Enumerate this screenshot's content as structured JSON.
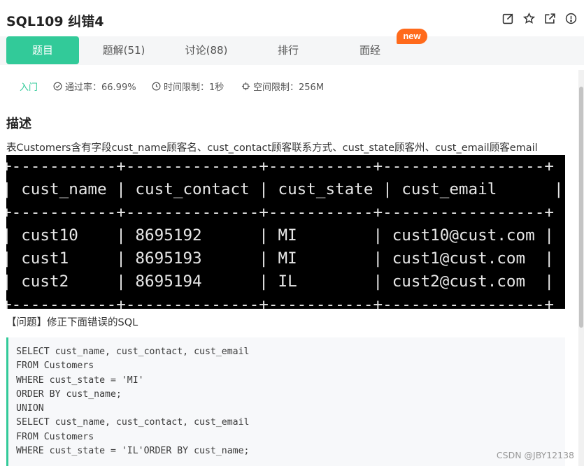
{
  "header": {
    "title": "SQL109  纠错4",
    "icons": [
      "edit-icon",
      "star-icon",
      "external-link-icon",
      "info-icon"
    ]
  },
  "tabs": [
    {
      "label": "题目",
      "active": true
    },
    {
      "label": "题解(51)",
      "active": false
    },
    {
      "label": "讨论(88)",
      "active": false
    },
    {
      "label": "排行",
      "active": false
    },
    {
      "label": "面经",
      "active": false
    }
  ],
  "new_badge": "new",
  "meta": {
    "level": "入门",
    "pass_rate": "通过率：66.99%",
    "time_limit": "时间限制：1秒",
    "space_limit": "空间限制：256M"
  },
  "section_title": "描述",
  "description": "表Customers含有字段cust_name顾客名、cust_contact顾客联系方式、cust_state顾客州、cust_email顾客email",
  "table_text": [
    "+-----------+--------------+-----------+-----------------+",
    "| cust_name | cust_contact | cust_state | cust_email      |",
    "+-----------+--------------+-----------+-----------------+",
    "| cust10    | 8695192      | MI        | cust10@cust.com |",
    "| cust1     | 8695193      | MI        | cust1@cust.com  |",
    "| cust2     | 8695194      | IL        | cust2@cust.com  |",
    "+-----------+--------------+-----------+-----------------+"
  ],
  "question": "【问题】修正下面错误的SQL",
  "code_lines": [
    "SELECT cust_name, cust_contact, cust_email",
    "FROM Customers",
    "WHERE cust_state = 'MI'",
    "ORDER BY cust_name;",
    "UNION",
    "SELECT cust_name, cust_contact, cust_email",
    "FROM Customers",
    "WHERE cust_state = 'IL'ORDER BY cust_name;"
  ],
  "watermark": "CSDN @JBY12138",
  "colors": {
    "accent": "#32ca99",
    "badge": "#ff6a1b",
    "terminal_bg": "#000000"
  }
}
